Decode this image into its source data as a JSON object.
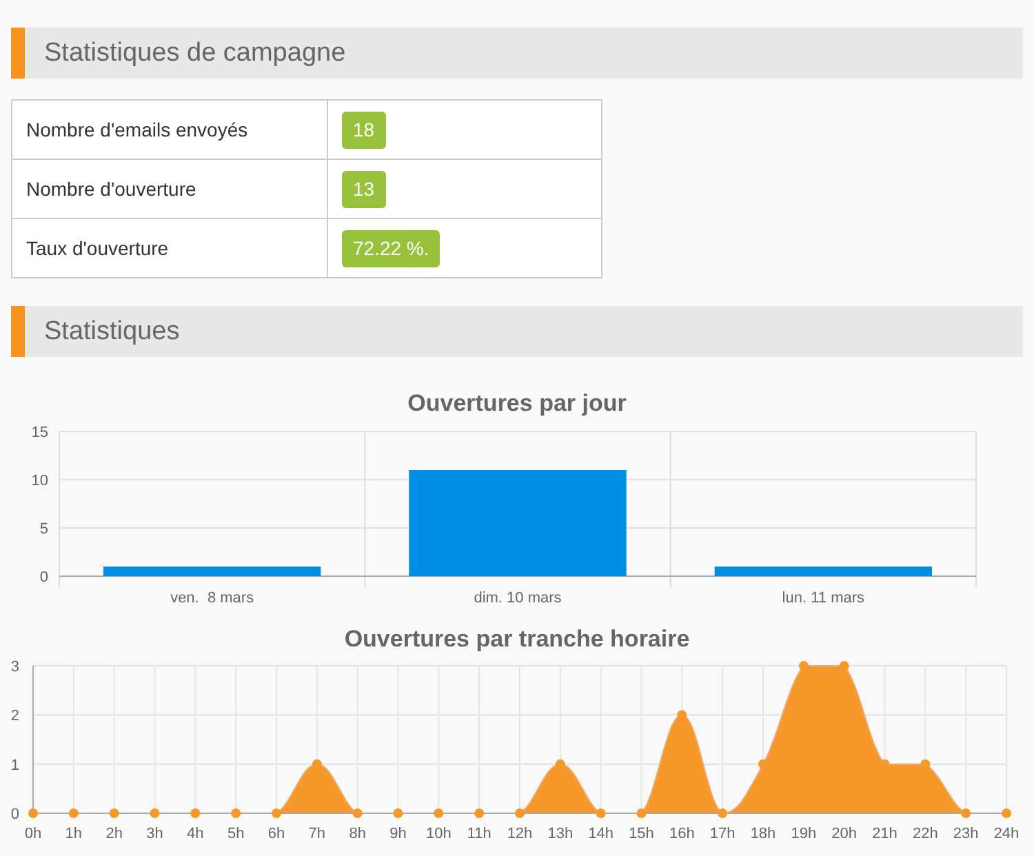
{
  "sections": [
    {
      "title": "Statistiques de campagne"
    },
    {
      "title": "Statistiques"
    }
  ],
  "stats_table": {
    "rows": [
      {
        "label": "Nombre d'emails envoyés",
        "value": "18"
      },
      {
        "label": "Nombre d'ouverture",
        "value": "13"
      },
      {
        "label": "Taux d'ouverture",
        "value": "72.22 %."
      }
    ]
  },
  "charts": [
    {
      "chart_data": {
        "type": "bar",
        "title": "Ouvertures par jour",
        "categories": [
          "ven.  8 mars",
          "dim. 10 mars",
          "lun. 11 mars"
        ],
        "series": [
          {
            "color": "#008ee4",
            "values": [
              1,
              11,
              1
            ]
          }
        ],
        "grid": true,
        "ylim": [
          0,
          15
        ],
        "yticks": [
          0,
          5,
          10,
          15
        ]
      }
    },
    {
      "chart_data": {
        "type": "area",
        "title": "Ouvertures par tranche horaire",
        "categories": [
          "0h",
          "1h",
          "2h",
          "3h",
          "4h",
          "5h",
          "6h",
          "7h",
          "8h",
          "9h",
          "10h",
          "11h",
          "12h",
          "13h",
          "14h",
          "15h",
          "16h",
          "17h",
          "18h",
          "19h",
          "20h",
          "21h",
          "22h",
          "23h",
          "24h"
        ],
        "grid": true,
        "series": [
          {
            "color": "#f7982a",
            "values": [
              0,
              0,
              0,
              0,
              0,
              0,
              0,
              1,
              0,
              0,
              0,
              0,
              0,
              1,
              0,
              0,
              2,
              0,
              1,
              3,
              3,
              1,
              1,
              0,
              0
            ]
          }
        ],
        "ylim": [
          0,
          3
        ],
        "yticks": [
          0,
          1,
          2,
          3
        ]
      }
    }
  ]
}
